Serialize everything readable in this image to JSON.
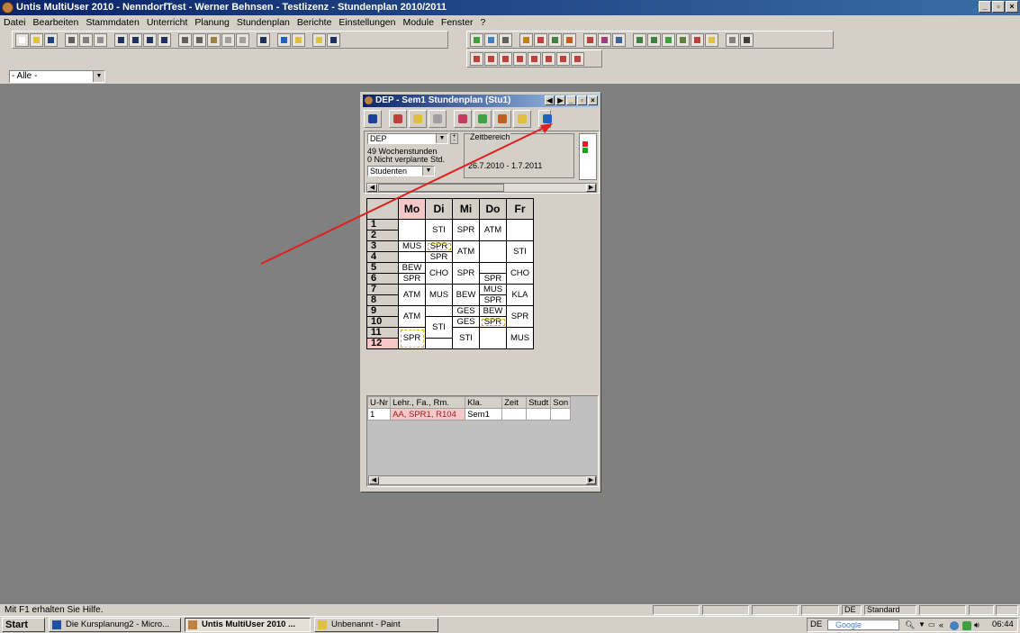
{
  "app": {
    "title": "Untis MultiUser 2010 - NenndorfTest - Werner Behnsen - Testlizenz - Stundenplan 2010/2011",
    "controls": {
      "minimize": "_",
      "restore": "▫",
      "close": "×"
    }
  },
  "menu": [
    "Datei",
    "Bearbeiten",
    "Stammdaten",
    "Unterricht",
    "Planung",
    "Stundenplan",
    "Berichte",
    "Einstellungen",
    "Module",
    "Fenster",
    "?"
  ],
  "filter": {
    "value": "- Alle -"
  },
  "child_window": {
    "title": "DEP - Sem1 Stundenplan (Stu1)",
    "element": "DEP",
    "wochenstunden": "49 Wochenstunden",
    "nicht_verplant": "0 Nicht verplante Std.",
    "view_select": "Studenten",
    "zeitbereich_label": "Zeitbereich",
    "zeitbereich_value": "26.7.2010 - 1.7.2011",
    "days": [
      "Mo",
      "Di",
      "Mi",
      "Do",
      "Fr"
    ],
    "periods": [
      "1",
      "2",
      "3",
      "4",
      "5",
      "6",
      "7",
      "8",
      "9",
      "10",
      "11",
      "12"
    ],
    "cells": {
      "r1": [
        "",
        "STI",
        "SPR",
        "ATM",
        ""
      ],
      "r3": [
        "MUS",
        "SPR",
        "ATM",
        "",
        "STI"
      ],
      "r4": [
        "",
        "SPR",
        "",
        "",
        ""
      ],
      "r5": [
        "BEW",
        "CHO",
        "SPR",
        "",
        "CHO"
      ],
      "r6": [
        "SPR",
        "",
        "",
        "SPR",
        ""
      ],
      "r7": [
        "ATM",
        "MUS",
        "BEW",
        "MUS",
        "KLA"
      ],
      "r8": [
        "",
        "",
        "",
        "SPR",
        ""
      ],
      "r9": [
        "ATM",
        "",
        "GES",
        "BEW",
        "SPR"
      ],
      "r10": [
        "",
        "STI",
        "GES",
        "SPR",
        ""
      ],
      "r11": [
        "SPR",
        "",
        "STI",
        "",
        "MUS"
      ]
    },
    "lesson_table": {
      "headers": [
        "U-Nr",
        "Lehr., Fa., Rm.",
        "Kla.",
        "Zeit",
        "Studt",
        "Son"
      ],
      "rows": [
        [
          "1",
          "AA, SPR1, R104",
          "Sem1",
          "",
          "",
          ""
        ]
      ]
    }
  },
  "statusbar": {
    "hint": "Mit F1 erhalten Sie Hilfe.",
    "lang": "DE",
    "mode": "Standard"
  },
  "taskbar": {
    "start": "Start",
    "tasks": [
      "Die Kursplanung2 - Micro...",
      "Untis MultiUser 2010 ...",
      "Unbenannt - Paint"
    ],
    "tray_lang": "DE",
    "tray_search": "Google",
    "clock": "06:44"
  },
  "colors": {
    "titlebar": "#0a246a",
    "desktop": "#808080",
    "highlight_day": "#f5c8c8",
    "arrow": "#e02020"
  }
}
